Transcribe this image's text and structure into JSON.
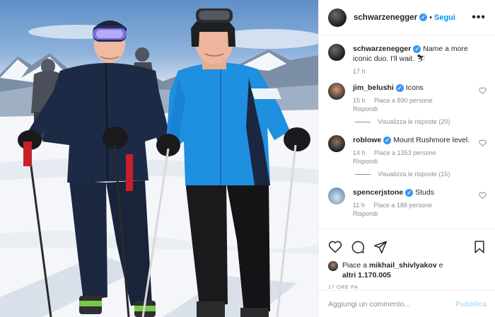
{
  "post": {
    "username": "schwarzenegger",
    "follow_label": "Segui",
    "more_label": "•••",
    "verified_mark": "✓"
  },
  "caption": {
    "username": "schwarzenegger",
    "text": "Name a more iconic duo. I'll wait. ⛷",
    "time": "17 h"
  },
  "comments": [
    {
      "username": "jim_belushi",
      "text": "Icons",
      "time": "15 h",
      "likes": "Piace a 890 persone",
      "reply": "Rispondi",
      "view_replies": "Visualizza le risposte (20)"
    },
    {
      "username": "roblowe",
      "text": "Mount Rushmore level.",
      "time": "14 h",
      "likes": "Piace a 1353 persone",
      "reply": "Rispondi",
      "view_replies": "Visualizza le risposte (15)"
    },
    {
      "username": "spencerjstone",
      "text": "Studs",
      "time": "11 h",
      "likes": "Piace a 188 persone",
      "reply": "Rispondi"
    }
  ],
  "actions": {
    "icons": [
      "heart-icon",
      "comment-icon",
      "share-icon",
      "bookmark-icon"
    ]
  },
  "likes": {
    "prefix": "Piace a ",
    "user": "mikhail_shivlyakov",
    "suffix": " e",
    "others": "altri 1.170.005"
  },
  "date_label": "17 ORE FA",
  "comment_box": {
    "placeholder": "Aggiungi un commento...",
    "publish_label": "Pubblica"
  },
  "colors": {
    "link_blue": "#0095f6",
    "publish_disabled": "#b2dffc",
    "jacket_blue": "#1f8fe0",
    "jacket_navy": "#1b2640"
  }
}
